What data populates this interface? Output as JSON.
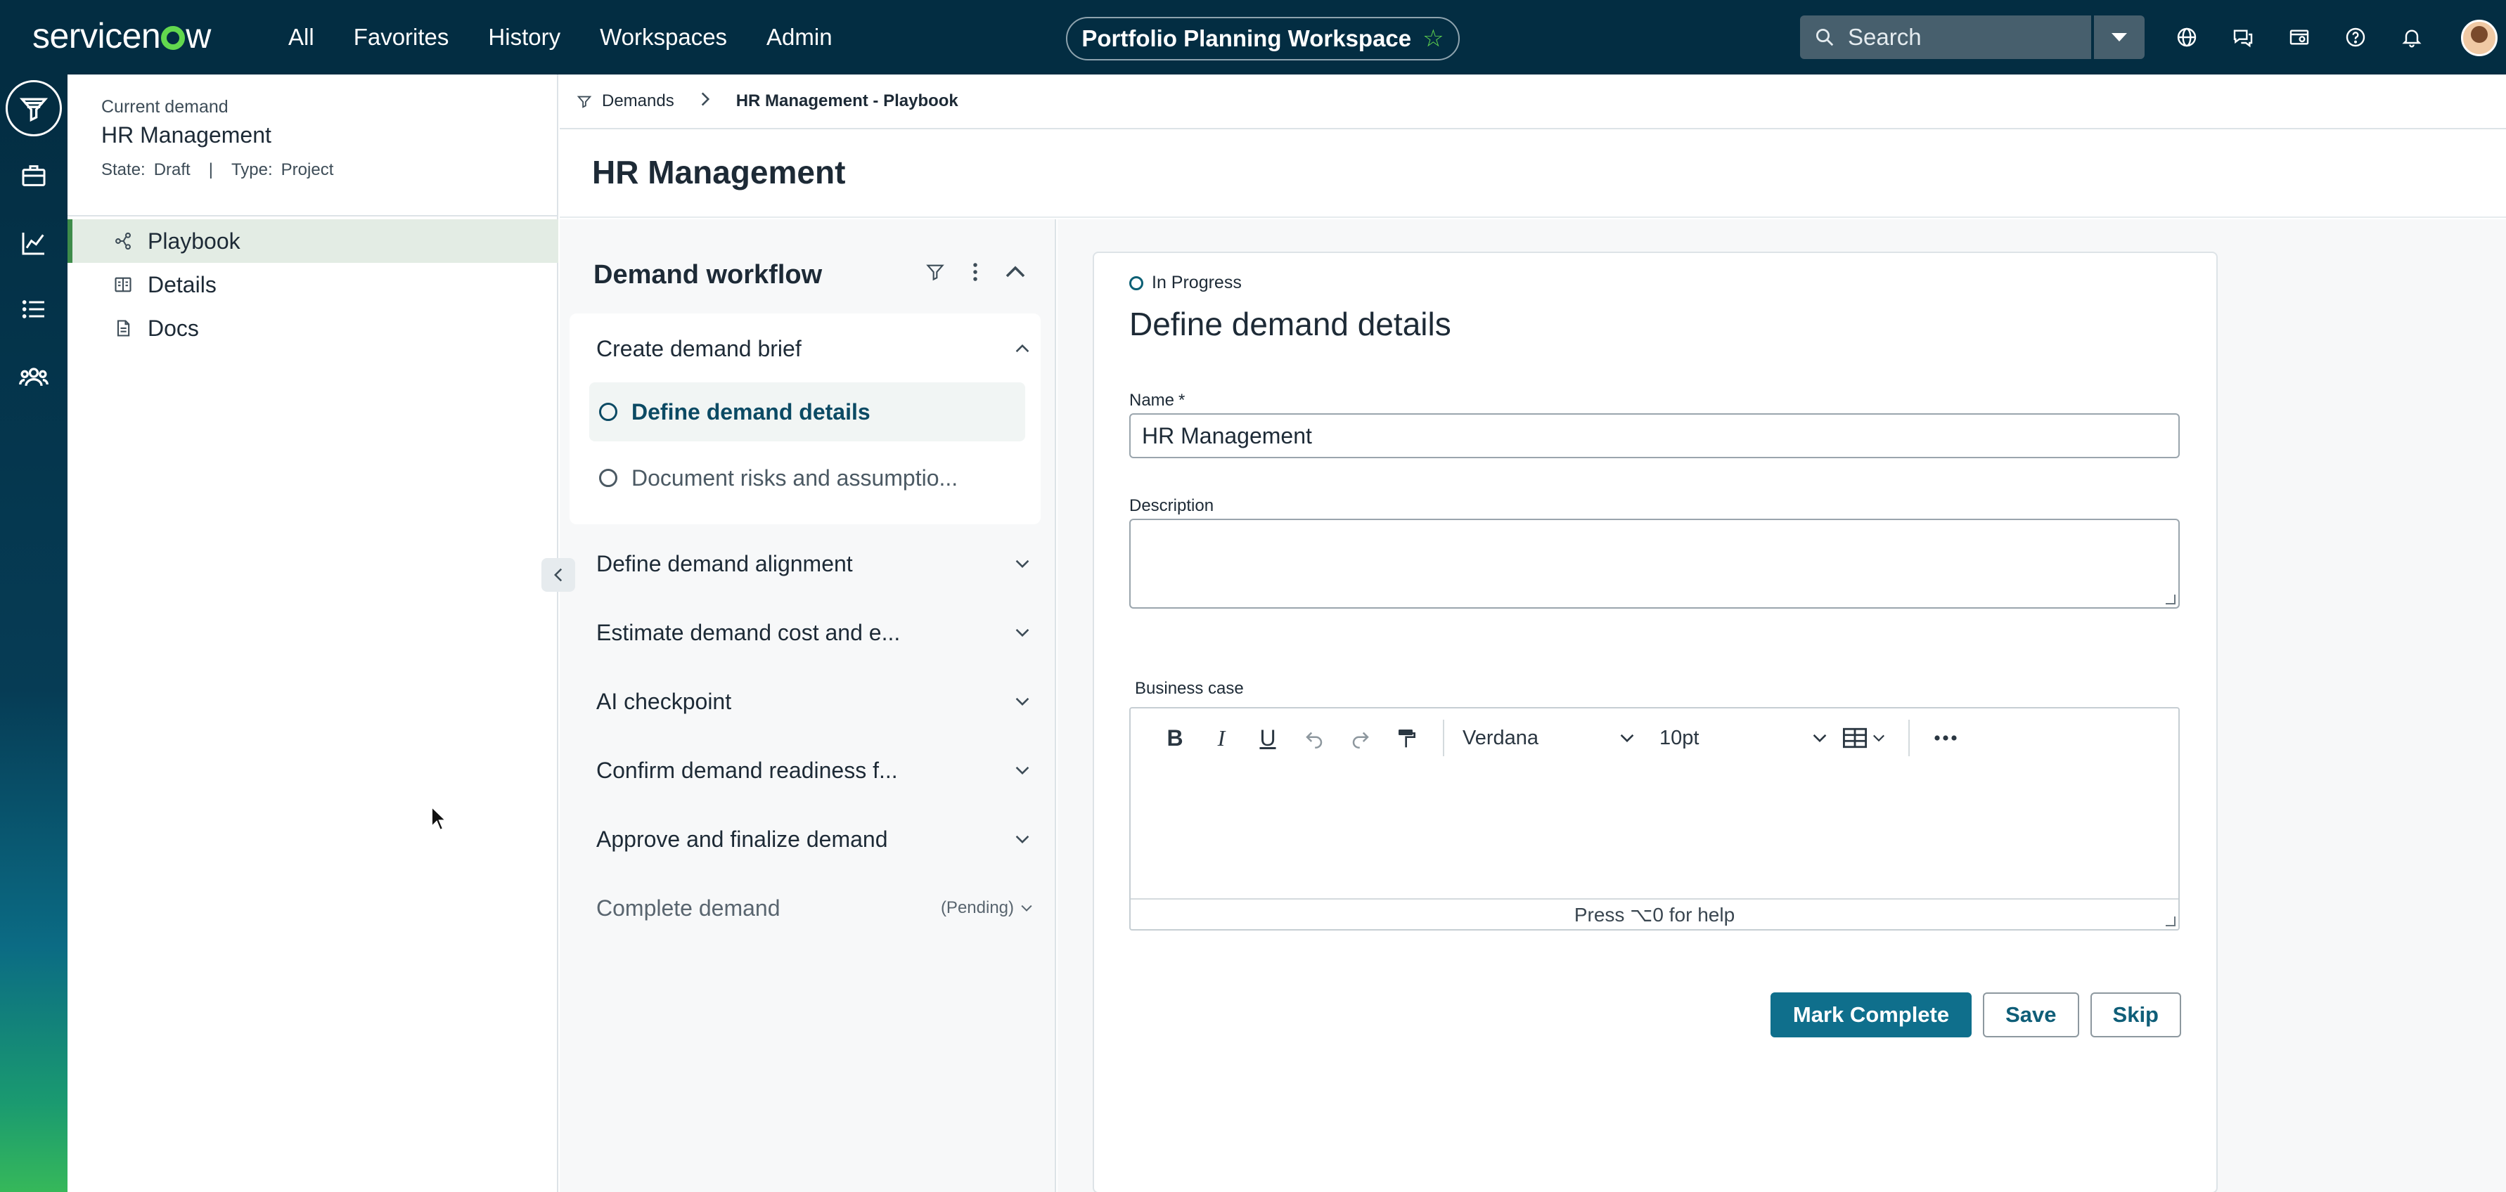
{
  "app": {
    "logo": "servicenow",
    "nav": [
      "All",
      "Favorites",
      "History",
      "Workspaces",
      "Admin"
    ],
    "workspace_title": "Portfolio Planning Workspace",
    "search_placeholder": "Search",
    "accent_color": "#62d84e"
  },
  "rail": {
    "items": [
      "filter-funnel-icon",
      "briefcase-icon",
      "chart-line-icon",
      "list-icon",
      "people-icon"
    ]
  },
  "left_panel": {
    "current_label": "Current demand",
    "title": "HR Management",
    "state_label": "State:",
    "state_value": "Draft",
    "separator": "|",
    "type_label": "Type:",
    "type_value": "Project",
    "items": [
      {
        "label": "Playbook",
        "active": true
      },
      {
        "label": "Details",
        "active": false
      },
      {
        "label": "Docs",
        "active": false
      }
    ]
  },
  "breadcrumb": {
    "root": "Demands",
    "current": "HR Management - Playbook"
  },
  "page": {
    "title": "HR Management"
  },
  "workflow": {
    "title": "Demand workflow",
    "sections": [
      {
        "label": "Create demand brief",
        "expanded": true,
        "tasks": [
          {
            "label": "Define demand details",
            "active": true
          },
          {
            "label": "Document risks and assumptio...",
            "active": false
          }
        ]
      },
      {
        "label": "Define demand alignment"
      },
      {
        "label": "Estimate demand cost and e..."
      },
      {
        "label": "AI checkpoint"
      },
      {
        "label": "Confirm demand readiness f..."
      },
      {
        "label": "Approve and finalize demand"
      },
      {
        "label": "Complete demand",
        "badge": "(Pending)"
      }
    ]
  },
  "form": {
    "status": "In Progress",
    "title": "Define demand details",
    "name_label": "Name",
    "name_required": "*",
    "name_value": "HR Management",
    "description_label": "Description",
    "description_value": "",
    "business_case_label": "Business case",
    "editor": {
      "font": "Verdana",
      "size": "10pt",
      "help": "Press ⌥0 for help"
    },
    "buttons": {
      "mark_complete": "Mark Complete",
      "save": "Save",
      "skip": "Skip"
    }
  }
}
